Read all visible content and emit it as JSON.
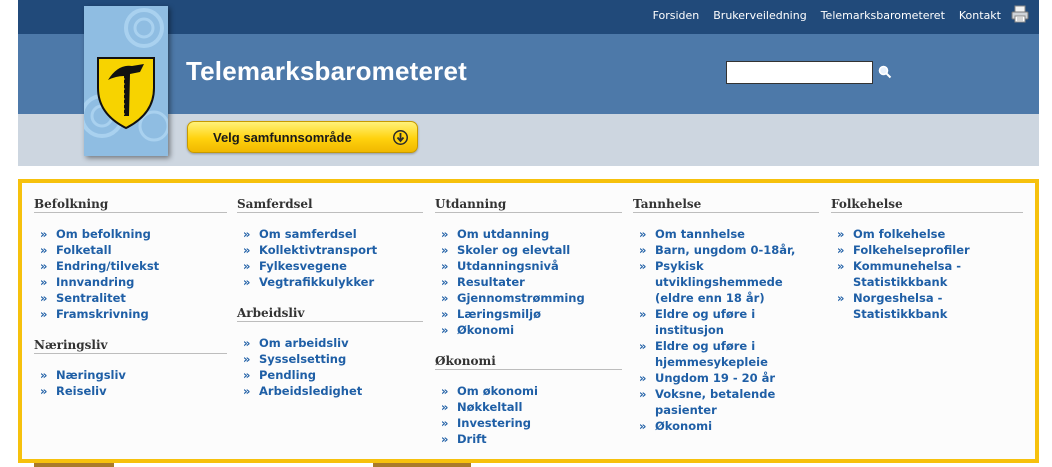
{
  "nav": {
    "links": [
      "Forsiden",
      "Brukerveiledning",
      "Telemarksbarometeret",
      "Kontakt"
    ],
    "print_icon": "printer-icon"
  },
  "header": {
    "title": "Telemarksbarometeret",
    "search_value": "",
    "search_icon": "magnifier-icon",
    "select_button": "Velg samfunnsområde",
    "select_icon": "circle-arrow-down-icon"
  },
  "colors": {
    "topbar": "#214a7a",
    "header": "#4d79a9",
    "subband": "#cdd6e0",
    "panel_border": "#f6c10d",
    "link": "#1f5fa6"
  },
  "menu": {
    "befolkning": {
      "title": "Befolkning",
      "items": [
        "Om befolkning",
        "Folketall",
        "Endring/tilvekst",
        "Innvandring",
        "Sentralitet",
        "Framskrivning"
      ]
    },
    "naeringsliv": {
      "title": "Næringsliv",
      "items": [
        "Næringsliv",
        "Reiseliv"
      ]
    },
    "samferdsel": {
      "title": "Samferdsel",
      "items": [
        "Om samferdsel",
        "Kollektivtransport",
        "Fylkesvegene",
        "Vegtrafikkulykker"
      ]
    },
    "arbeidsliv": {
      "title": "Arbeidsliv",
      "items": [
        "Om arbeidsliv",
        "Sysselsetting",
        "Pendling",
        "Arbeidsledighet"
      ]
    },
    "utdanning": {
      "title": "Utdanning",
      "items": [
        "Om utdanning",
        "Skoler og elevtall",
        "Utdanningsnivå",
        "Resultater",
        "Gjennomstrømming",
        "Læringsmiljø",
        "Økonomi"
      ]
    },
    "okonomi": {
      "title": "Økonomi",
      "items": [
        "Om økonomi",
        "Nøkkeltall",
        "Investering",
        "Drift"
      ]
    },
    "tannhelse": {
      "title": "Tannhelse",
      "items": [
        "Om tannhelse",
        "Barn, ungdom 0-18år,",
        "Psykisk utviklingshemmede (eldre enn 18 år)",
        "Eldre og uføre i institusjon",
        "Eldre og uføre i hjemmesykepleie",
        "Ungdom 19 - 20 år",
        "Voksne, betalende pasienter",
        "Økonomi"
      ]
    },
    "folkehelse": {
      "title": "Folkehelse",
      "items": [
        "Om folkehelse",
        "Folkehelseprofiler",
        "Kommunehelsa - Statistikkbank",
        "Norgeshelsa - Statistikkbank"
      ]
    }
  }
}
